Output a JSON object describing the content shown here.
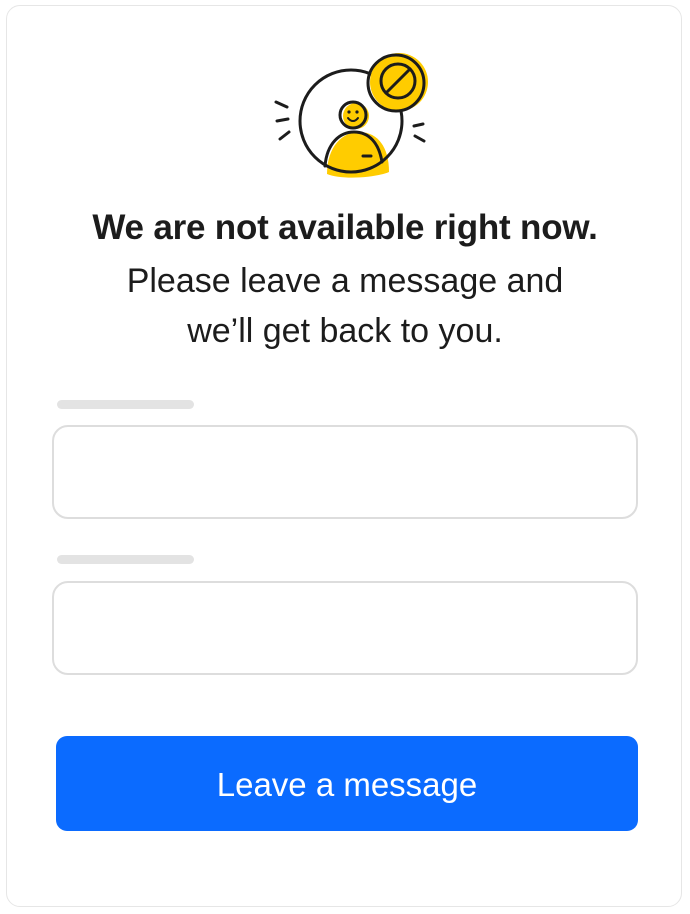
{
  "heading": {
    "title": "We are not available right now.",
    "line1": "Please leave a message and",
    "line2": "we’ll get back to you."
  },
  "form": {
    "field1_value": "",
    "field2_value": ""
  },
  "button": {
    "label": "Leave a message"
  },
  "colors": {
    "accent": "#0b6bff",
    "illustration_yellow": "#ffcc00",
    "text": "#1c1c1c"
  },
  "icons": {
    "illustration": "unavailable-agent-icon"
  }
}
